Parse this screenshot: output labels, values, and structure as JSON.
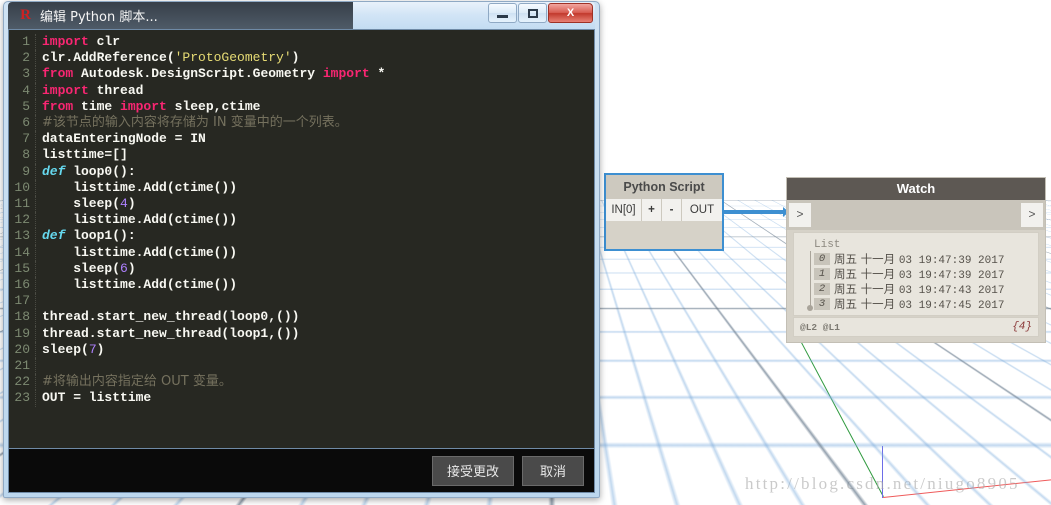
{
  "viewport": {
    "watermark": "http://blog.csdn.net/niugo8905",
    "axis_colors": {
      "x": "#ef5a5a",
      "y": "#2f9a3f",
      "z": "#6d6de8"
    },
    "grid_minor_color": "#78aadc",
    "grid_major_color": "#6e7378"
  },
  "dialog": {
    "title": "编辑 Python 脚本...",
    "icon": "dynamo-r-icon",
    "window_buttons": [
      {
        "name": "minimize-button",
        "glyph": "—"
      },
      {
        "name": "maximize-button",
        "glyph": "□"
      },
      {
        "name": "close-button",
        "glyph": "X"
      }
    ],
    "buttons": {
      "accept_label": "接受更改",
      "cancel_label": "取消"
    },
    "editor": {
      "background": "#272822",
      "lines": [
        {
          "n": "1",
          "segs": [
            {
              "t": "import",
              "c": "kw"
            },
            {
              "t": " clr",
              "c": "id"
            }
          ]
        },
        {
          "n": "2",
          "segs": [
            {
              "t": "clr.AddReference(",
              "c": "id"
            },
            {
              "t": "'ProtoGeometry'",
              "c": "str"
            },
            {
              "t": ")",
              "c": "id"
            }
          ]
        },
        {
          "n": "3",
          "segs": [
            {
              "t": "from",
              "c": "kw"
            },
            {
              "t": " Autodesk.DesignScript.Geometry ",
              "c": "id"
            },
            {
              "t": "import",
              "c": "kw"
            },
            {
              "t": " *",
              "c": "id"
            }
          ]
        },
        {
          "n": "4",
          "segs": [
            {
              "t": "import",
              "c": "kw"
            },
            {
              "t": " thread",
              "c": "id"
            }
          ]
        },
        {
          "n": "5",
          "segs": [
            {
              "t": "from",
              "c": "kw"
            },
            {
              "t": " time ",
              "c": "id"
            },
            {
              "t": "import",
              "c": "kw"
            },
            {
              "t": " sleep,ctime",
              "c": "id"
            }
          ]
        },
        {
          "n": "6",
          "segs": [
            {
              "t": "#该节点的输入内容将存储为 IN 变量中的一个列表。",
              "c": "cmt"
            }
          ]
        },
        {
          "n": "7",
          "segs": [
            {
              "t": "dataEnteringNode = IN",
              "c": "id"
            }
          ]
        },
        {
          "n": "8",
          "segs": [
            {
              "t": "listtime=[]",
              "c": "id"
            }
          ]
        },
        {
          "n": "9",
          "segs": [
            {
              "t": "def",
              "c": "kwd"
            },
            {
              "t": " loop0():",
              "c": "id"
            }
          ]
        },
        {
          "n": "10",
          "segs": [
            {
              "t": "    listtime.Add(ctime())",
              "c": "id"
            }
          ]
        },
        {
          "n": "11",
          "segs": [
            {
              "t": "    sleep(",
              "c": "id"
            },
            {
              "t": "4",
              "c": "num"
            },
            {
              "t": ")",
              "c": "id"
            }
          ]
        },
        {
          "n": "12",
          "segs": [
            {
              "t": "    listtime.Add(ctime())",
              "c": "id"
            }
          ]
        },
        {
          "n": "13",
          "segs": [
            {
              "t": "def",
              "c": "kwd"
            },
            {
              "t": " loop1():",
              "c": "id"
            }
          ]
        },
        {
          "n": "14",
          "segs": [
            {
              "t": "    listtime.Add(ctime())",
              "c": "id"
            }
          ]
        },
        {
          "n": "15",
          "segs": [
            {
              "t": "    sleep(",
              "c": "id"
            },
            {
              "t": "6",
              "c": "num"
            },
            {
              "t": ")",
              "c": "id"
            }
          ]
        },
        {
          "n": "16",
          "segs": [
            {
              "t": "    listtime.Add(ctime())",
              "c": "id"
            }
          ]
        },
        {
          "n": "17",
          "segs": []
        },
        {
          "n": "18",
          "segs": [
            {
              "t": "thread.start_new_thread(loop0,())",
              "c": "id"
            }
          ]
        },
        {
          "n": "19",
          "segs": [
            {
              "t": "thread.start_new_thread(loop1,())",
              "c": "id"
            }
          ]
        },
        {
          "n": "20",
          "segs": [
            {
              "t": "sleep(",
              "c": "id"
            },
            {
              "t": "7",
              "c": "num"
            },
            {
              "t": ")",
              "c": "id"
            }
          ]
        },
        {
          "n": "21",
          "segs": []
        },
        {
          "n": "22",
          "segs": [
            {
              "t": "#将输出内容指定给 OUT 变量。",
              "c": "cmt"
            }
          ]
        },
        {
          "n": "23",
          "segs": [
            {
              "t": "OUT = listtime",
              "c": "id"
            }
          ]
        }
      ]
    }
  },
  "nodes": {
    "python_script": {
      "title": "Python Script",
      "ports": [
        {
          "name": "input-port-in0",
          "label": "IN[0]"
        },
        {
          "name": "add-port-button",
          "label": "+"
        },
        {
          "name": "remove-port-button",
          "label": "-"
        },
        {
          "name": "output-port-out",
          "label": "OUT"
        }
      ],
      "border_color": "#3d8fd1"
    },
    "watch": {
      "title": "Watch",
      "input_port_label": ">",
      "output_port_label": ">",
      "list_label": "List",
      "items": [
        {
          "index": "0",
          "value": "周五 十一月 03 19:47:39 2017"
        },
        {
          "index": "1",
          "value": "周五 十一月 03 19:47:39 2017"
        },
        {
          "index": "2",
          "value": "周五 十一月 03 19:47:43 2017"
        },
        {
          "index": "3",
          "value": "周五 十一月 03 19:47:45 2017"
        }
      ],
      "lacing": "@L2 @L1",
      "count": "{4}"
    },
    "wire": {
      "color": "#3d8fd1"
    }
  }
}
